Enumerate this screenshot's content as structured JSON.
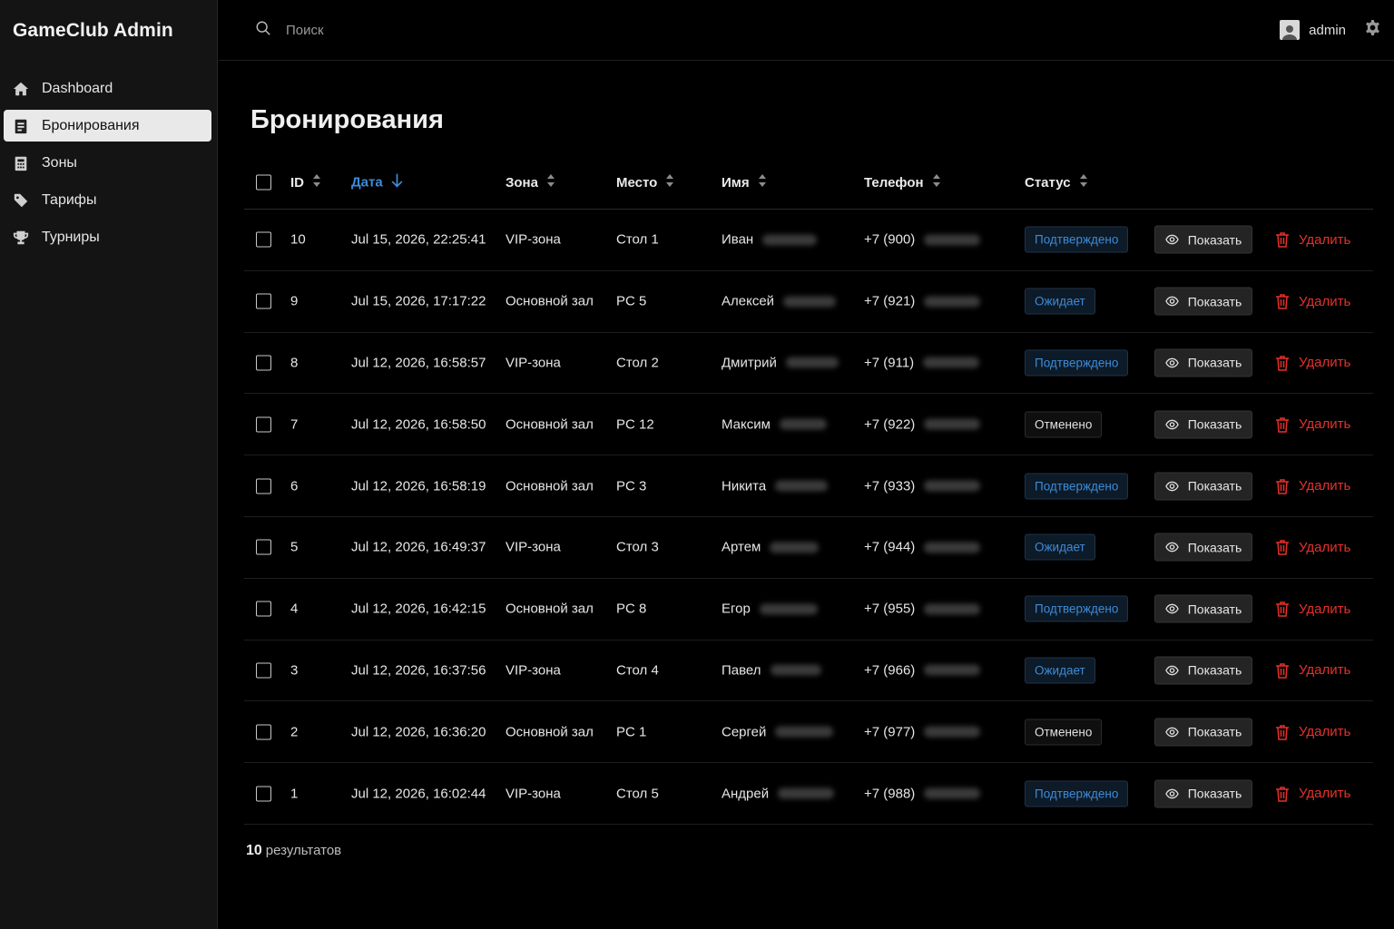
{
  "app": {
    "title": "GameClub Admin"
  },
  "sidebar": {
    "items": [
      {
        "label": "Dashboard",
        "icon": "home-icon",
        "active": false
      },
      {
        "label": "Бронирования",
        "icon": "bookings-icon",
        "active": true
      },
      {
        "label": "Зоны",
        "icon": "zones-icon",
        "active": false
      },
      {
        "label": "Тарифы",
        "icon": "tag-icon",
        "active": false
      },
      {
        "label": "Турниры",
        "icon": "trophy-icon",
        "active": false
      }
    ]
  },
  "topbar": {
    "search_placeholder": "Поиск",
    "username": "admin"
  },
  "page": {
    "title": "Бронирования"
  },
  "table": {
    "columns": [
      "ID",
      "Дата",
      "Зона",
      "Место",
      "Имя",
      "Телефон",
      "Статус"
    ],
    "sorted_column": "Дата",
    "sort_direction": "desc",
    "actions": {
      "show_label": "Показать",
      "delete_label": "Удалить"
    },
    "rows": [
      {
        "id": "10",
        "date": "Jul 15, 2026, 22:25:41",
        "zone": "VIP-зона",
        "place": "Стол 1",
        "name": "Иван",
        "phone": "+7 (900)",
        "status": "Подтверждено",
        "status_kind": "confirmed"
      },
      {
        "id": "9",
        "date": "Jul 15, 2026, 17:17:22",
        "zone": "Основной зал",
        "place": "PC 5",
        "name": "Алексей",
        "phone": "+7 (921)",
        "status": "Ожидает",
        "status_kind": "pending"
      },
      {
        "id": "8",
        "date": "Jul 12, 2026, 16:58:57",
        "zone": "VIP-зона",
        "place": "Стол 2",
        "name": "Дмитрий",
        "phone": "+7 (911)",
        "status": "Подтверждено",
        "status_kind": "confirmed"
      },
      {
        "id": "7",
        "date": "Jul 12, 2026, 16:58:50",
        "zone": "Основной зал",
        "place": "PC 12",
        "name": "Максим",
        "phone": "+7 (922)",
        "status": "Отменено",
        "status_kind": "cancelled"
      },
      {
        "id": "6",
        "date": "Jul 12, 2026, 16:58:19",
        "zone": "Основной зал",
        "place": "PC 3",
        "name": "Никита",
        "phone": "+7 (933)",
        "status": "Подтверждено",
        "status_kind": "confirmed"
      },
      {
        "id": "5",
        "date": "Jul 12, 2026, 16:49:37",
        "zone": "VIP-зона",
        "place": "Стол 3",
        "name": "Артем",
        "phone": "+7 (944)",
        "status": "Ожидает",
        "status_kind": "pending"
      },
      {
        "id": "4",
        "date": "Jul 12, 2026, 16:42:15",
        "zone": "Основной зал",
        "place": "PC 8",
        "name": "Егор",
        "phone": "+7 (955)",
        "status": "Подтверждено",
        "status_kind": "confirmed"
      },
      {
        "id": "3",
        "date": "Jul 12, 2026, 16:37:56",
        "zone": "VIP-зона",
        "place": "Стол 4",
        "name": "Павел",
        "phone": "+7 (966)",
        "status": "Ожидает",
        "status_kind": "pending"
      },
      {
        "id": "2",
        "date": "Jul 12, 2026, 16:36:20",
        "zone": "Основной зал",
        "place": "PC 1",
        "name": "Сергей",
        "phone": "+7 (977)",
        "status": "Отменено",
        "status_kind": "cancelled"
      },
      {
        "id": "1",
        "date": "Jul 12, 2026, 16:02:44",
        "zone": "VIP-зона",
        "place": "Стол 5",
        "name": "Андрей",
        "phone": "+7 (988)",
        "status": "Подтверждено",
        "status_kind": "confirmed"
      }
    ]
  },
  "footer": {
    "count": "10",
    "count_label": "результатов"
  },
  "colors": {
    "accent": "#3d8bd9",
    "danger": "#e5312b",
    "background": "#000000",
    "sidebar": "#141414"
  }
}
